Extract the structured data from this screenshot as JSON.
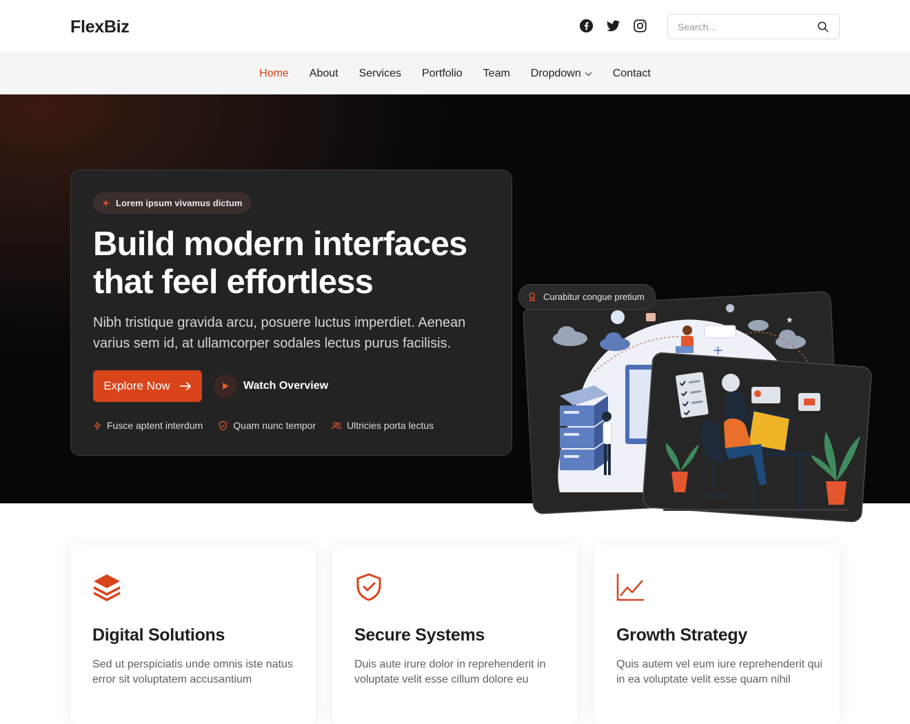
{
  "header": {
    "logo": "FlexBiz",
    "socials": [
      "facebook-icon",
      "twitter-icon",
      "instagram-icon"
    ],
    "search_placeholder": "Search..."
  },
  "nav": {
    "items": [
      {
        "label": "Home",
        "active": true
      },
      {
        "label": "About"
      },
      {
        "label": "Services"
      },
      {
        "label": "Portfolio"
      },
      {
        "label": "Team"
      },
      {
        "label": "Dropdown",
        "dropdown": true
      },
      {
        "label": "Contact"
      }
    ]
  },
  "hero": {
    "badge": "Lorem ipsum vivamus dictum",
    "title_line1": "Build modern interfaces",
    "title_line2": "that feel effortless",
    "description": "Nibh tristique gravida arcu, posuere luctus imperdiet. Aenean varius sem id, at ullamcorper sodales lectus purus facilisis.",
    "primary_button": "Explore Now",
    "secondary_button": "Watch Overview",
    "features": [
      {
        "label": "Fusce aptent interdum",
        "icon": "bolt-icon"
      },
      {
        "label": "Quam nunc tempor",
        "icon": "shield-icon"
      },
      {
        "label": "Ultricies porta lectus",
        "icon": "users-icon"
      }
    ],
    "illustration_pill": "Curabitur congue pretium"
  },
  "cards": [
    {
      "title": "Digital Solutions",
      "text": "Sed ut perspiciatis unde omnis iste natus error sit voluptatem accusantium",
      "icon": "layers-icon"
    },
    {
      "title": "Secure Systems",
      "text": "Duis aute irure dolor in reprehenderit in voluptate velit esse cillum dolore eu",
      "icon": "shield-check-icon"
    },
    {
      "title": "Growth Strategy",
      "text": "Quis autem vel eum iure reprehenderit qui in ea voluptate velit esse quam nihil",
      "icon": "chart-line-icon"
    }
  ],
  "colors": {
    "accent": "#d9441b",
    "hero_card": "#232323",
    "nav_bg": "#f5f5f5"
  }
}
